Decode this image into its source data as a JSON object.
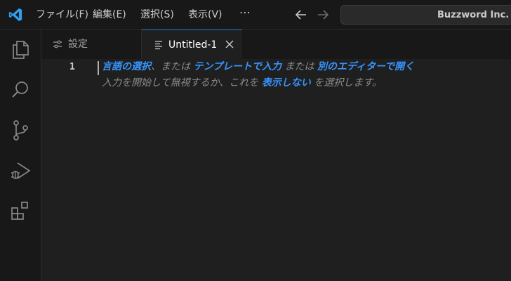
{
  "menu": {
    "file": "ファイル(F)",
    "edit": "編集(E)",
    "selection": "選択(S)",
    "view": "表示(V)",
    "more": "⋯"
  },
  "search": {
    "text": "Buzzword Inc."
  },
  "tabs": [
    {
      "label": "設定"
    },
    {
      "label": "Untitled-1"
    }
  ],
  "editor": {
    "line_number": "1",
    "hint_line1": {
      "link_language": "言語の選択",
      "text_or1": "、または",
      "link_template": "テンプレートで入力",
      "text_or2": "または",
      "link_other_editor": "別のエディターで開く"
    },
    "hint_line2": {
      "text_start": "入力を開始して無視するか、これを",
      "link_hide": "表示しない",
      "text_end": "を選択します。"
    }
  },
  "colors": {
    "accent": "#0078d4",
    "link": "#3794ff",
    "background": "#1f1f1f",
    "chrome": "#181818"
  }
}
